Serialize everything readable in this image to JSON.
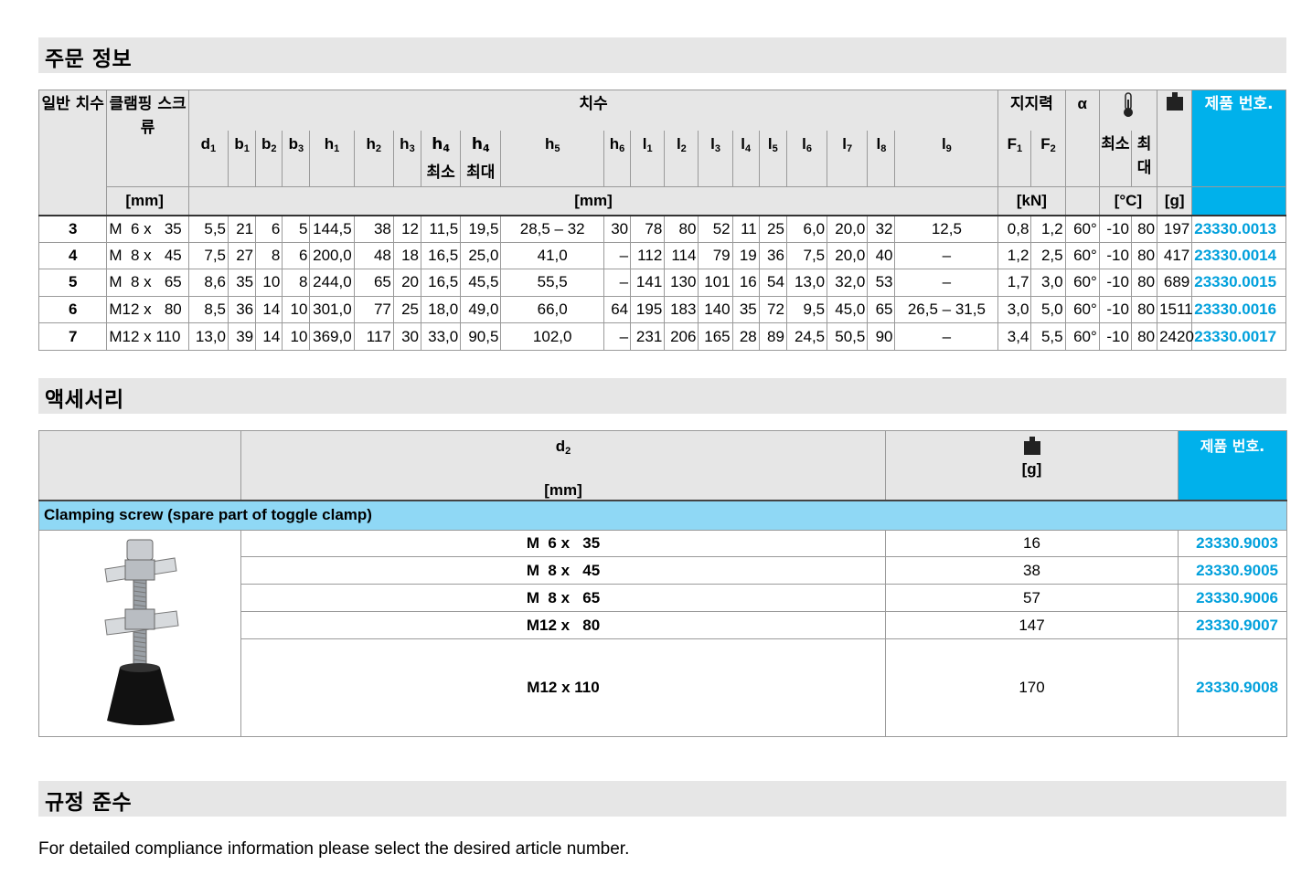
{
  "sections": {
    "order_info": "주문 정보",
    "accessories": "액세서리",
    "compliance": "규정 준수"
  },
  "order_table": {
    "headers": {
      "general_size": "일반 치수",
      "clamping_screw": "클램핑 스크류",
      "dimensions": "치수",
      "holding_force": "지지력",
      "alpha": "α",
      "product_no": "제품 번호.",
      "unit_mm": "[mm]",
      "unit_kn": "[kN]",
      "unit_c": "[°C]",
      "unit_g": "[g]",
      "min": "최소",
      "max": "최대",
      "temp_min": "최소",
      "temp_max": "최대",
      "h5": "h",
      "l9": "l"
    },
    "rows": [
      [
        "3",
        "M  6 x   35",
        "5,5",
        "21",
        "6",
        "5",
        "144,5",
        "38",
        "12",
        "11,5",
        "19,5",
        "28,5 – 32",
        "30",
        "78",
        "80",
        "52",
        "11",
        "25",
        "6,0",
        "20,0",
        "32",
        "12,5",
        "0,8",
        "1,2",
        "60°",
        "-10",
        "80",
        "197",
        "23330.0013"
      ],
      [
        "4",
        "M  8 x   45",
        "7,5",
        "27",
        "8",
        "6",
        "200,0",
        "48",
        "18",
        "16,5",
        "25,0",
        "41,0",
        "–",
        "112",
        "114",
        "79",
        "19",
        "36",
        "7,5",
        "20,0",
        "40",
        "–",
        "1,2",
        "2,5",
        "60°",
        "-10",
        "80",
        "417",
        "23330.0014"
      ],
      [
        "5",
        "M  8 x   65",
        "8,6",
        "35",
        "10",
        "8",
        "244,0",
        "65",
        "20",
        "16,5",
        "45,5",
        "55,5",
        "–",
        "141",
        "130",
        "101",
        "16",
        "54",
        "13,0",
        "32,0",
        "53",
        "–",
        "1,7",
        "3,0",
        "60°",
        "-10",
        "80",
        "689",
        "23330.0015"
      ],
      [
        "6",
        "M12 x   80",
        "8,5",
        "36",
        "14",
        "10",
        "301,0",
        "77",
        "25",
        "18,0",
        "49,0",
        "66,0",
        "64",
        "195",
        "183",
        "140",
        "35",
        "72",
        "9,5",
        "45,0",
        "65",
        "26,5 – 31,5",
        "3,0",
        "5,0",
        "60°",
        "-10",
        "80",
        "1511",
        "23330.0016"
      ],
      [
        "7",
        "M12 x 110",
        "13,0",
        "39",
        "14",
        "10",
        "369,0",
        "117",
        "30",
        "33,0",
        "90,5",
        "102,0",
        "–",
        "231",
        "206",
        "165",
        "28",
        "89",
        "24,5",
        "50,5",
        "90",
        "–",
        "3,4",
        "5,5",
        "60°",
        "-10",
        "80",
        "2420",
        "23330.0017"
      ]
    ]
  },
  "accessories_table": {
    "headers": {
      "d2": "d",
      "unit_mm": "[mm]",
      "unit_g": "[g]",
      "product_no": "제품 번호."
    },
    "category": "Clamping screw (spare part of toggle clamp)",
    "rows": [
      {
        "size": "M  6 x   35",
        "weight": "16",
        "pn": "23330.9003"
      },
      {
        "size": "M  8 x   45",
        "weight": "38",
        "pn": "23330.9005"
      },
      {
        "size": "M  8 x   65",
        "weight": "57",
        "pn": "23330.9006"
      },
      {
        "size": "M12 x   80",
        "weight": "147",
        "pn": "23330.9007"
      },
      {
        "size": "M12 x 110",
        "weight": "170",
        "pn": "23330.9008"
      }
    ]
  },
  "compliance_text": "For detailed compliance information please select the desired article number.",
  "colors": {
    "section_bg": "#e6e6e6",
    "product_no_header": "#00b1eb",
    "product_no_text": "#00a0dc",
    "category_bg": "#8fd8f5"
  },
  "icons": {
    "temperature": "thermometer-icon",
    "weight": "weight-icon"
  }
}
